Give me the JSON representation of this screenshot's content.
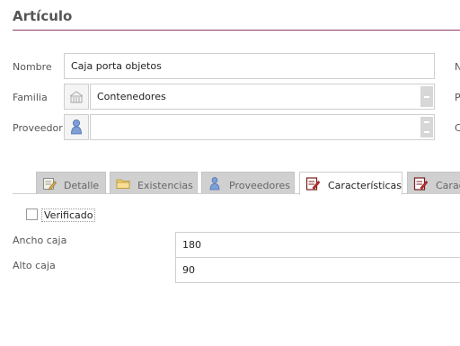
{
  "header": {
    "title": "Artículo"
  },
  "form": {
    "nombre": {
      "label": "Nombre",
      "value": "Caja porta objetos"
    },
    "familia": {
      "label": "Familia",
      "value": "Contenedores"
    },
    "proveedor": {
      "label": "Proveedor",
      "value": ""
    }
  },
  "right_edge_labels": [
    "N",
    "P",
    "C"
  ],
  "tabs": [
    {
      "label": "Detalle",
      "icon": "edit-note-icon"
    },
    {
      "label": "Existencias",
      "icon": "folder-icon"
    },
    {
      "label": "Proveedores",
      "icon": "person-icon"
    },
    {
      "label": "Características",
      "icon": "notepad-pen-icon",
      "active": true
    },
    {
      "label": "Carac",
      "icon": "notepad-pen-icon"
    }
  ],
  "characteristics": {
    "verificado": {
      "label": "Verificado",
      "checked": false
    },
    "ancho": {
      "label": "Ancho caja",
      "value": "180"
    },
    "alto": {
      "label": "Alto caja",
      "value": "90"
    }
  },
  "colors": {
    "accent_rule": "#8e3c6e",
    "tab_inactive": "#d0d0d0"
  }
}
